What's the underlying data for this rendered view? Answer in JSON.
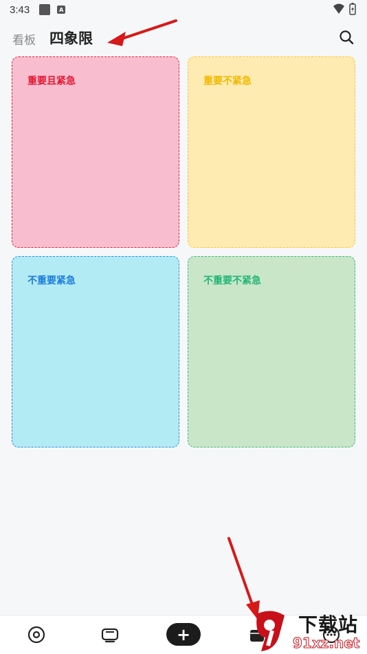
{
  "status_bar": {
    "time": "3:43",
    "notification_letter": "A"
  },
  "header": {
    "tab_board": "看板",
    "tab_quadrant": "四象限",
    "search_icon": "search-icon"
  },
  "quadrants": [
    {
      "label": "重要且紧急",
      "color": "#e2172f",
      "background": "#f9bdd0"
    },
    {
      "label": "重要不紧急",
      "color": "#f0b800",
      "background": "#feebb1"
    },
    {
      "label": "不重要紧急",
      "color": "#1a7ddc",
      "background": "#b3ebf4"
    },
    {
      "label": "不重要不紧急",
      "color": "#22b577",
      "background": "#c9e6c9"
    }
  ],
  "bottom_nav": {
    "items": [
      "target-icon",
      "tv-icon",
      "add-icon",
      "calendar-icon",
      "more-icon"
    ],
    "add_glyph": "+"
  },
  "watermark": {
    "title": "下载站",
    "domain": "91xz.net"
  },
  "annotations": {
    "arrow_color": "#d81818"
  }
}
